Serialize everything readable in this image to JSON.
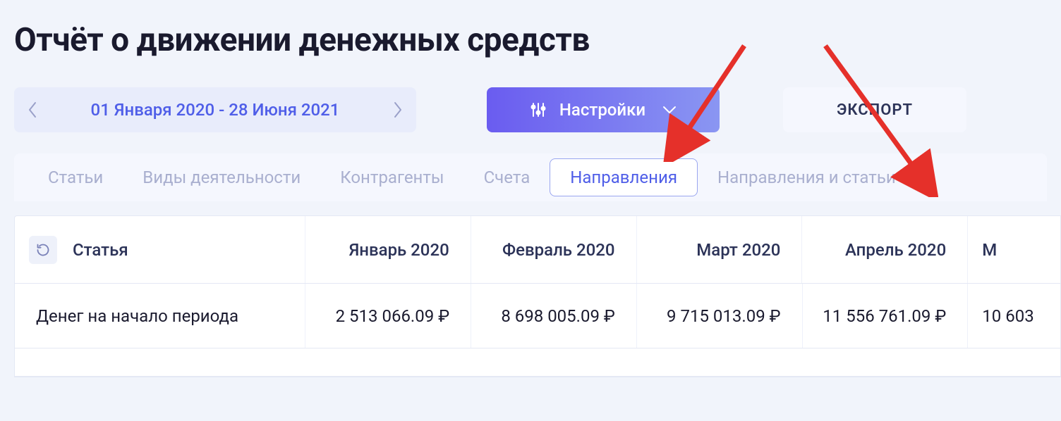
{
  "title": "Отчёт о движении денежных средств",
  "date_range": "01 Января 2020 - 28 Июня 2021",
  "settings_label": "Настройки",
  "export_label": "ЭКСПОРТ",
  "tabs": [
    {
      "label": "Статьи",
      "active": false
    },
    {
      "label": "Виды деятельности",
      "active": false
    },
    {
      "label": "Контрагенты",
      "active": false
    },
    {
      "label": "Счета",
      "active": false
    },
    {
      "label": "Направления",
      "active": true
    },
    {
      "label": "Направления и статьи",
      "active": false
    }
  ],
  "table": {
    "header_first": "Статья",
    "columns": [
      "Январь 2020",
      "Февраль 2020",
      "Март 2020",
      "Апрель 2020"
    ],
    "column_partial": "М",
    "rows": [
      {
        "label": "Денег на начало периода",
        "cells": [
          "2 513 066.09 ₽",
          "8 698 005.09 ₽",
          "9 715 013.09 ₽",
          "11 556 761.09 ₽"
        ],
        "cell_partial": "10 603"
      }
    ]
  }
}
